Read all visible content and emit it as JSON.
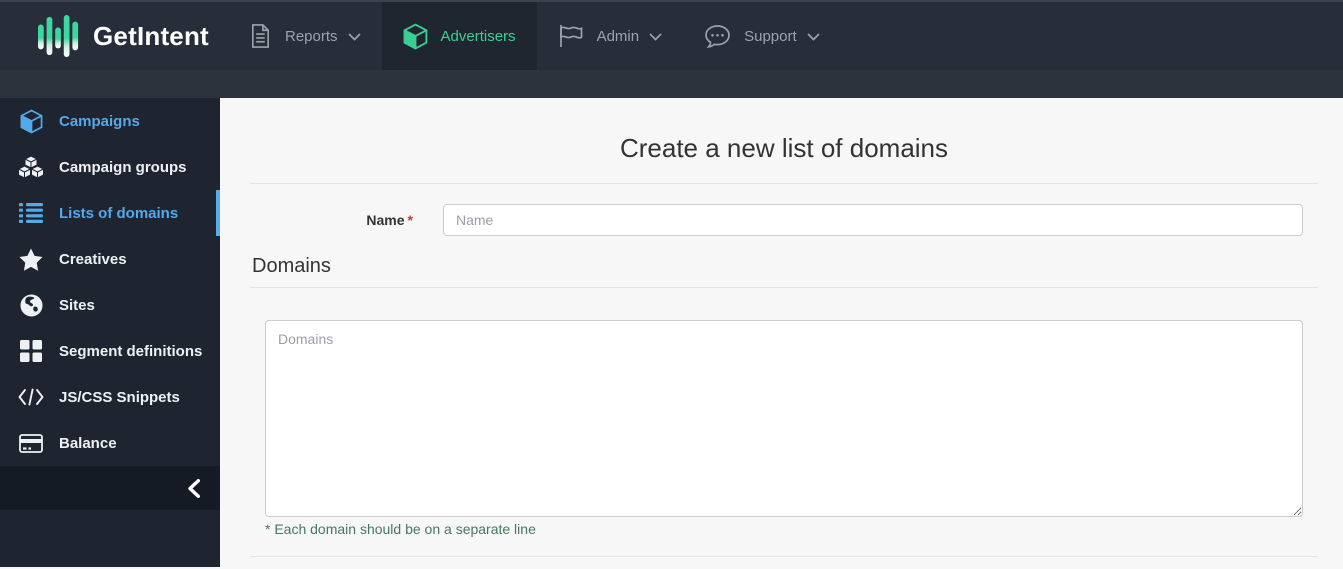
{
  "brand": {
    "name": "GetIntent"
  },
  "topnav": {
    "items": [
      {
        "label": "Reports",
        "icon": "document-icon",
        "has_chevron": true,
        "active": false
      },
      {
        "label": "Advertisers",
        "icon": "cube-icon",
        "has_chevron": false,
        "active": true
      },
      {
        "label": "Admin",
        "icon": "flag-icon",
        "has_chevron": true,
        "active": false
      },
      {
        "label": "Support",
        "icon": "chat-icon",
        "has_chevron": true,
        "active": false
      }
    ]
  },
  "sidebar": {
    "items": [
      {
        "label": "Campaigns",
        "icon": "cube-icon",
        "highlighted": true,
        "active": false
      },
      {
        "label": "Campaign groups",
        "icon": "cubes-icon",
        "highlighted": false,
        "active": false
      },
      {
        "label": "Lists of domains",
        "icon": "list-icon",
        "highlighted": true,
        "active": true
      },
      {
        "label": "Creatives",
        "icon": "star-icon",
        "highlighted": false,
        "active": false
      },
      {
        "label": "Sites",
        "icon": "globe-icon",
        "highlighted": false,
        "active": false
      },
      {
        "label": "Segment definitions",
        "icon": "grid-icon",
        "highlighted": false,
        "active": false
      },
      {
        "label": "JS/CSS Snippets",
        "icon": "code-icon",
        "highlighted": false,
        "active": false
      },
      {
        "label": "Balance",
        "icon": "credit-card-icon",
        "highlighted": false,
        "active": false
      }
    ]
  },
  "main": {
    "title": "Create a new list of domains",
    "form": {
      "name_label": "Name",
      "required_marker": "*",
      "name_placeholder": "Name",
      "name_value": "",
      "section_title": "Domains",
      "domains_placeholder": "Domains",
      "domains_value": "",
      "helper_note": "* Each domain should be on a separate line"
    }
  },
  "colors": {
    "accent_teal": "#3ace92",
    "accent_blue": "#55aeea",
    "required_red": "#b1403d",
    "helper_green": "#44795f",
    "topbar_bg": "#272e39",
    "sidebar_bg": "#1e2531"
  }
}
